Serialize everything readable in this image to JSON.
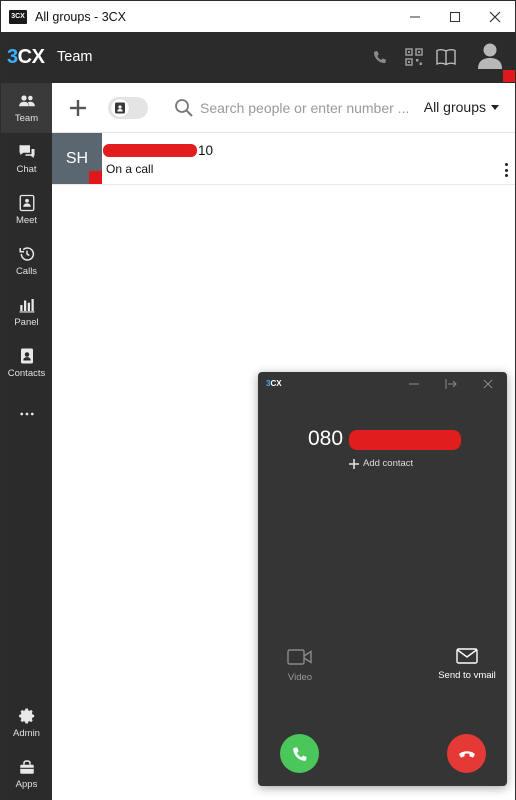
{
  "window": {
    "title": "All groups - 3CX",
    "logo_text": "3CX"
  },
  "header": {
    "brand_prefix": "3",
    "brand_suffix": "CX",
    "section_title": "Team"
  },
  "sidebar": {
    "items": [
      {
        "label": "Team",
        "icon": "team-icon"
      },
      {
        "label": "Chat",
        "icon": "chat-icon"
      },
      {
        "label": "Meet",
        "icon": "meet-icon"
      },
      {
        "label": "Calls",
        "icon": "history-icon"
      },
      {
        "label": "Panel",
        "icon": "panel-icon"
      },
      {
        "label": "Contacts",
        "icon": "contacts-icon"
      },
      {
        "label": "Admin",
        "icon": "gear-icon"
      },
      {
        "label": "Apps",
        "icon": "apps-icon"
      }
    ]
  },
  "toolbar": {
    "search_placeholder": "Search people or enter number ...",
    "group_filter": "All groups"
  },
  "contacts": [
    {
      "initials": "SH",
      "name_visible": "10",
      "status": "On a call",
      "status_color": "#e0181b"
    }
  ],
  "call_popup": {
    "logo_prefix": "3",
    "logo_suffix": "CX",
    "number_visible": "080",
    "add_contact": "Add contact",
    "video_label": "Video",
    "vmail_label": "Send to vmail"
  },
  "colors": {
    "dark_bg": "#2b2b2b",
    "accent_blue": "#3ab0ff",
    "status_red": "#e0181b",
    "answer_green": "#4bc65a",
    "decline_red": "#e53935"
  }
}
